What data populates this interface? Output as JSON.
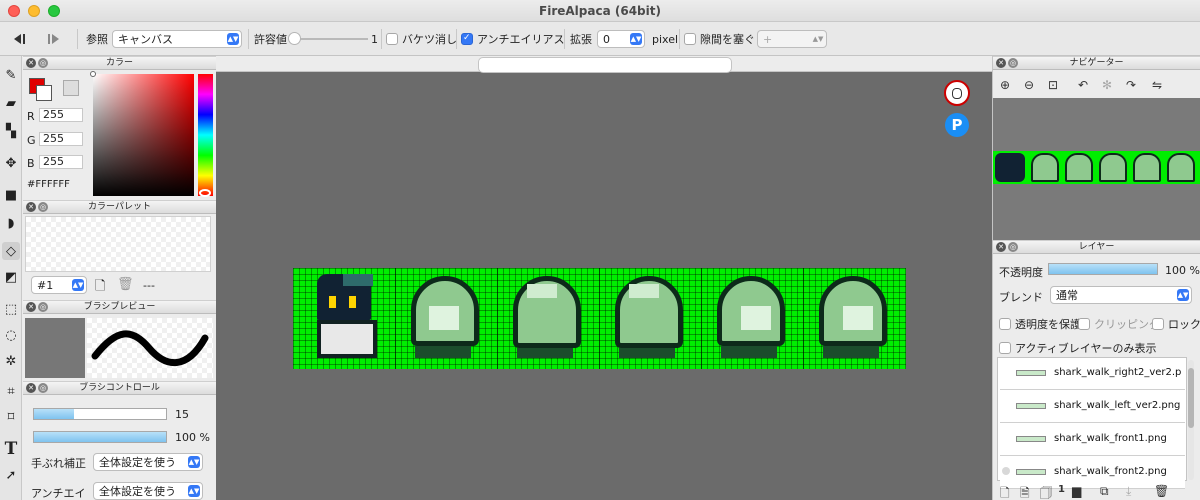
{
  "window": {
    "title": "FireAlpaca (64bit)"
  },
  "toolbar": {
    "reference_label": "参照",
    "reference_value": "キャンバス",
    "tolerance_label": "許容値",
    "tolerance_value": "1",
    "bucket_erase_label": "バケツ消し",
    "antialias_label": "アンチエイリアス",
    "expand_label": "拡張",
    "expand_value": "0",
    "expand_unit": "pixel",
    "close_gap_label": "隙間を塞ぐ",
    "close_gap_value": "+"
  },
  "color_panel": {
    "title": "カラー",
    "r_label": "R",
    "r_value": "255",
    "g_label": "G",
    "g_value": "255",
    "b_label": "B",
    "b_value": "255",
    "hex": "#FFFFFF"
  },
  "palette_panel": {
    "title": "カラーパレット",
    "palette_select": "#1",
    "extra": "---"
  },
  "brush_preview_panel": {
    "title": "ブラシプレビュー"
  },
  "brush_control_panel": {
    "title": "ブラシコントロール",
    "size_value": "15",
    "opacity_value": "100 %",
    "stabilizer_label": "手ぶれ補正",
    "stabilizer_value": "全体設定を使う",
    "antialias_label": "アンチエイ",
    "antialias_value": "全体設定を使う"
  },
  "navigator_panel": {
    "title": "ナビゲーター"
  },
  "layer_panel": {
    "title": "レイヤー",
    "opacity_label": "不透明度",
    "opacity_value": "100 %",
    "blend_label": "ブレンド",
    "blend_value": "通常",
    "protect_alpha_label": "透明度を保護",
    "clipping_label": "クリッピング",
    "lock_label": "ロック",
    "active_only_label": "アクティブレイヤーのみ表示",
    "layers": [
      {
        "name": "shark_walk_right2_ver2.p"
      },
      {
        "name": "shark_walk_left_ver2.png"
      },
      {
        "name": "shark_walk_front1.png"
      },
      {
        "name": "shark_walk_front2.png"
      }
    ]
  }
}
